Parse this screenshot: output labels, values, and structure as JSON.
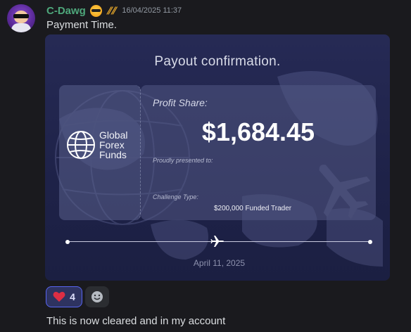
{
  "message": {
    "username": "C-Dawg",
    "timestamp": "16/04/2025 11:37",
    "text": "Payment Time.",
    "emoji": "sunglasses-emoji",
    "badge_text": "𝔥𝔥",
    "colors": {
      "username": "#4ea77b",
      "background": "#1a1a1e"
    }
  },
  "embed": {
    "title": "Payout confirmation.",
    "logo_lines": [
      "Global",
      "Forex",
      "Funds"
    ],
    "profit_share_label": "Profit Share:",
    "amount": "$1,684.45",
    "presented_label": "Proudly presented to:",
    "challenge_type_label": "Challenge Type:",
    "challenge_type_value": "$200,000 Funded Trader",
    "date": "April 11, 2025",
    "icons": [
      "globe-icon",
      "plane-icon"
    ],
    "colors": {
      "card": "#262a55",
      "accent": "#ffffff"
    }
  },
  "reactions": [
    {
      "emoji": "red-heart-icon",
      "count": "4"
    }
  ],
  "add_reaction_icon": "smiley-icon",
  "reply": {
    "text": "This is now cleared and in my account"
  }
}
